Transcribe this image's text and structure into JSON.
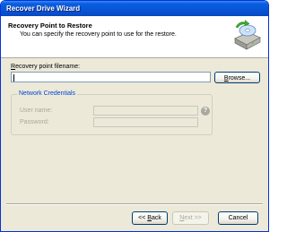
{
  "window": {
    "title": "Recover Drive Wizard"
  },
  "header": {
    "title": "Recovery Point to Restore",
    "subtitle": "You can specify the recovery point to use for the restore.",
    "icon": "drive-restore-icon"
  },
  "form": {
    "filename_label_prefix": "R",
    "filename_label_rest": "ecovery point filename:",
    "filename_value": "",
    "browse_label_prefix": "B",
    "browse_label_rest": "rowse...",
    "credentials_group": "Network Credentials",
    "username_label": "User name:",
    "username_value": "",
    "password_label": "Password:",
    "password_value": "",
    "help_icon": "?"
  },
  "footer": {
    "back_label_pre": "<< ",
    "back_label_u": "B",
    "back_label_post": "ack",
    "next_label_pre": "",
    "next_label_u": "N",
    "next_label_post": "ext >>",
    "cancel_label": "Cancel"
  },
  "colors": {
    "titlebar": "#0854d7",
    "face": "#ece9d8",
    "group_legend": "#0046d5",
    "disabled_text": "#aca899"
  }
}
